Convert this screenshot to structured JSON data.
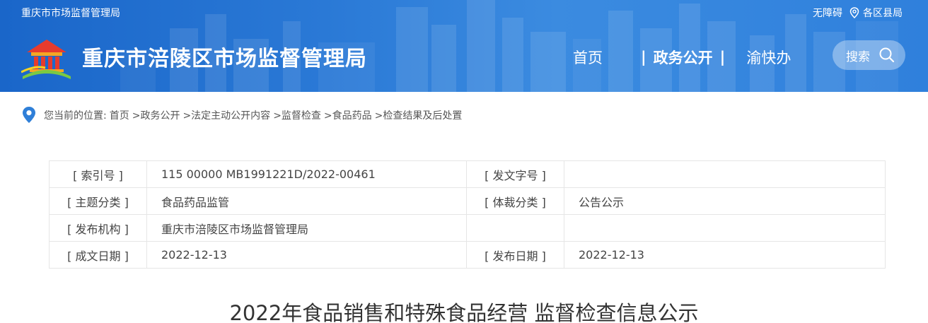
{
  "header": {
    "top_left": "重庆市市场监督管理局",
    "accessibility": "无障碍",
    "districts": "各区县局",
    "site_title": "重庆市涪陵区市场监督管理局",
    "nav": {
      "home": "首页",
      "sep1": "|",
      "gov": "政务公开",
      "sep2": "|",
      "yukuai": "渝快办"
    },
    "search_label": "搜索"
  },
  "breadcrumb": {
    "prefix": "您当前的位置:",
    "items": [
      "首页",
      ">政务公开",
      ">法定主动公开内容",
      ">监督检查",
      ">食品药品",
      ">检查结果及后处置"
    ]
  },
  "meta": {
    "rows": [
      {
        "k1": "[ 索引号 ]",
        "v1": "115 00000 MB1991221D/2022-00461",
        "k2": "[ 发文字号 ]",
        "v2": ""
      },
      {
        "k1": "[ 主题分类 ]",
        "v1": "食品药品监管",
        "k2": "[ 体裁分类 ]",
        "v2": "公告公示"
      },
      {
        "k1": "[ 发布机构 ]",
        "v1": "重庆市涪陵区市场监督管理局",
        "k2": "",
        "v2": ""
      },
      {
        "k1": "[ 成文日期 ]",
        "v1": "2022-12-13",
        "k2": "[ 发布日期 ]",
        "v2": "2022-12-13"
      }
    ]
  },
  "article": {
    "title": "2022年食品销售和特殊食品经营 监督检查信息公示"
  },
  "colors": {
    "header_blue": "#2a79d6",
    "crumb_pin": "#2f7fd8"
  },
  "icons": {
    "location": "location-pin-icon",
    "search": "search-icon",
    "logo": "logo-emblem-icon"
  }
}
